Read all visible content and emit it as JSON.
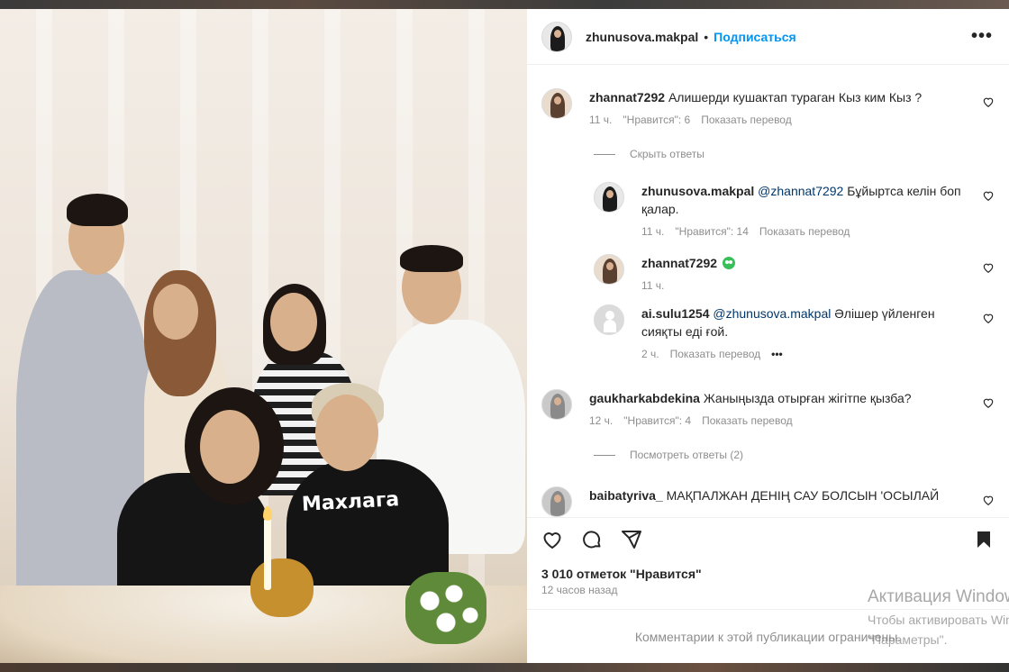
{
  "header": {
    "username": "zhunusova.makpal",
    "separator": "•",
    "follow_label": "Подписаться",
    "more_label": "•••"
  },
  "comments": [
    {
      "username": "zhannat7292",
      "text": "Алишерди кушактап тураган Кыз ким Кыз ?",
      "time": "11 ч.",
      "likes": "\"Нравится\": 6",
      "translate": "Показать перевод",
      "toggle": "Скрыть ответы",
      "replies": [
        {
          "username": "zhunusova.makpal",
          "mention": "@zhannat7292",
          "text": "Бұйыртса келін боп қалар.",
          "time": "11 ч.",
          "likes": "\"Нравится\": 14",
          "translate": "Показать перевод"
        },
        {
          "username": "zhannat7292",
          "text": "",
          "emoji": "smiling-face-emoji",
          "time": "11 ч."
        },
        {
          "username": "ai.sulu1254",
          "mention": "@zhunusova.makpal",
          "text": "Әлішер үйленген сияқты еді ғой.",
          "time": "2 ч.",
          "translate": "Показать перевод",
          "more": "•••"
        }
      ]
    },
    {
      "username": "gaukharkabdekina",
      "text": "Жаныңызда отырған жігітпе қызба?",
      "time": "12 ч.",
      "likes": "\"Нравится\": 4",
      "translate": "Показать перевод",
      "toggle": "Посмотреть ответы (2)"
    },
    {
      "username": "baibatyriva_",
      "text": "МАҚПАЛЖАН ДЕНІҢ САУ БОЛСЫН 'ОСЫЛАЙ"
    }
  ],
  "photo": {
    "shirt_text": "Махлага"
  },
  "post": {
    "likes_label": "3 010 отметок \"Нравится\"",
    "time_label": "12 часов назад",
    "comments_closed": "Комментарии к этой публикации ограничены."
  },
  "watermark": {
    "title": "Активация Windows",
    "line1": "Чтобы активировать Windows,",
    "line2": "\"Параметры\"."
  },
  "colors": {
    "accent": "#0095f6",
    "mention": "#00376b",
    "secondary_text": "#8e8e8e",
    "primary_text": "#262626"
  }
}
